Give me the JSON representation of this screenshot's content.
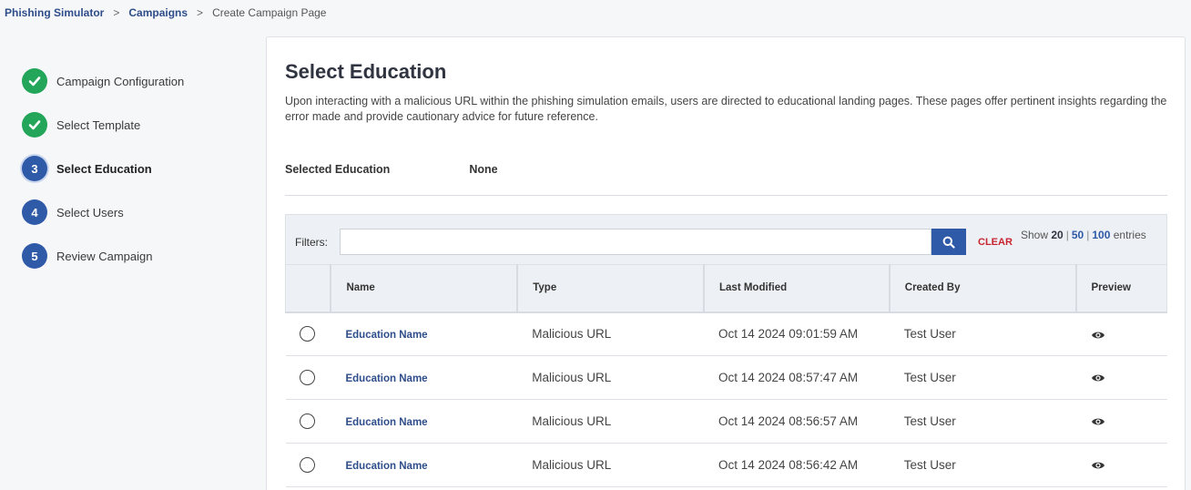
{
  "breadcrumb": {
    "items": [
      "Phishing Simulator",
      "Campaigns"
    ],
    "separator": ">",
    "current": "Create Campaign Page"
  },
  "steps": [
    {
      "label": "Campaign Configuration",
      "status": "done",
      "number": ""
    },
    {
      "label": "Select Template",
      "status": "done",
      "number": ""
    },
    {
      "label": "Select Education",
      "status": "active",
      "number": "3"
    },
    {
      "label": "Select Users",
      "status": "pending",
      "number": "4"
    },
    {
      "label": "Review Campaign",
      "status": "pending",
      "number": "5"
    }
  ],
  "main": {
    "title": "Select Education",
    "description": "Upon interacting with a malicious URL within the phishing simulation emails, users are directed to educational landing pages. These pages offer pertinent insights regarding the error made and provide cautionary advice for future reference.",
    "selected_label": "Selected Education",
    "selected_value": "None"
  },
  "filters": {
    "label": "Filters:",
    "input_value": "",
    "clear_label": "CLEAR",
    "show_prefix": "Show",
    "show_options": [
      "20",
      "50",
      "100"
    ],
    "show_suffix": "entries"
  },
  "table": {
    "columns": [
      "",
      "Name",
      "Type",
      "Last Modified",
      "Created By",
      "Preview"
    ],
    "rows": [
      {
        "name": "Education Name",
        "type": "Malicious URL",
        "modified": "Oct 14 2024 09:01:59 AM",
        "created_by": "Test User"
      },
      {
        "name": "Education Name",
        "type": "Malicious URL",
        "modified": "Oct 14 2024 08:57:47 AM",
        "created_by": "Test User"
      },
      {
        "name": "Education Name",
        "type": "Malicious URL",
        "modified": "Oct 14 2024 08:56:57 AM",
        "created_by": "Test User"
      },
      {
        "name": "Education Name",
        "type": "Malicious URL",
        "modified": "Oct 14 2024 08:56:42 AM",
        "created_by": "Test User"
      }
    ]
  },
  "icons": {
    "done": "check-icon",
    "search": "search-icon",
    "preview": "eye-icon"
  },
  "colors": {
    "brand": "#2e5aa8",
    "success": "#23a55a",
    "danger": "#c8242f"
  }
}
